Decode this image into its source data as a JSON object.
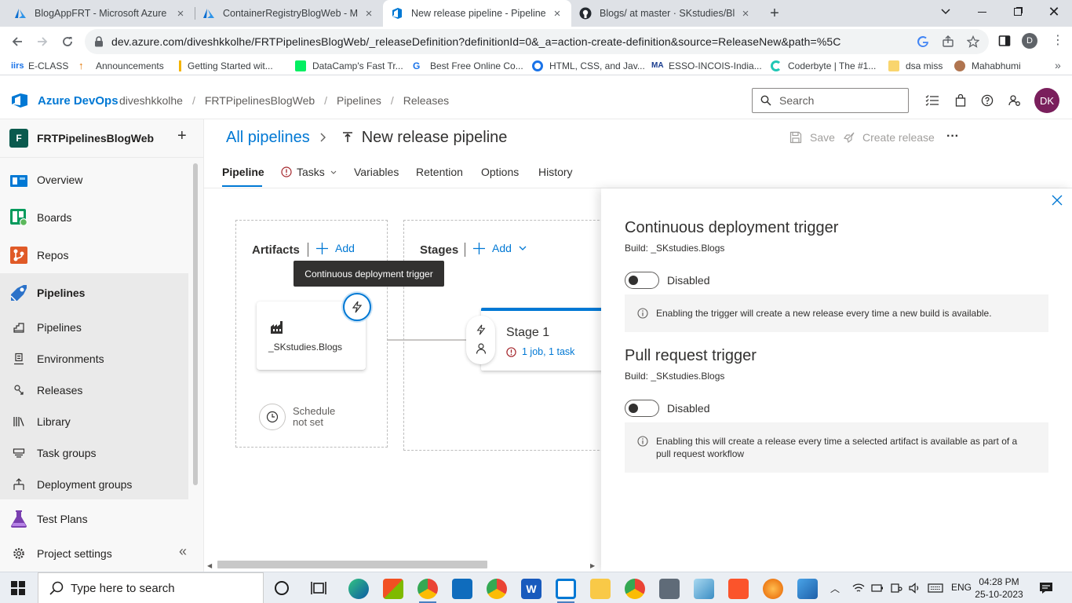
{
  "browser": {
    "tabs": [
      {
        "title": "BlogAppFRT - Microsoft Azure",
        "active": false
      },
      {
        "title": "ContainerRegistryBlogWeb - Mic",
        "active": false
      },
      {
        "title": "New release pipeline - Pipelines",
        "active": true
      },
      {
        "title": "Blogs/ at master · SKstudies/Blog",
        "active": false
      }
    ],
    "url": "dev.azure.com/diveshkkolhe/FRTPipelinesBlogWeb/_releaseDefinition?definitionId=0&_a=action-create-definition&source=ReleaseNew&path=%5C",
    "profile_initial": "D",
    "bookmarks": [
      "E-CLASS",
      "Announcements",
      "Getting Started wit...",
      "DataCamp's Fast Tr...",
      "Best Free Online Co...",
      "HTML, CSS, and Jav...",
      "ESSO-INCOIS-India...",
      "Coderbyte | The #1...",
      "dsa miss",
      "Mahabhumi"
    ]
  },
  "header": {
    "brand": "Azure DevOps",
    "breadcrumbs": [
      "diveshkkolhe",
      "FRTPipelinesBlogWeb",
      "Pipelines",
      "Releases"
    ],
    "search_placeholder": "Search",
    "avatar_initials": "DK"
  },
  "sidebar": {
    "project_initial": "F",
    "project_name": "FRTPipelinesBlogWeb",
    "add_label": "+",
    "items": [
      {
        "label": "Overview"
      },
      {
        "label": "Boards"
      },
      {
        "label": "Repos"
      },
      {
        "label": "Pipelines"
      }
    ],
    "subitems": [
      {
        "label": "Pipelines"
      },
      {
        "label": "Environments"
      },
      {
        "label": "Releases"
      },
      {
        "label": "Library"
      },
      {
        "label": "Task groups"
      },
      {
        "label": "Deployment groups"
      }
    ],
    "test_plans": "Test Plans",
    "project_settings": "Project settings",
    "collapse_glyph": "«"
  },
  "main": {
    "all_pipelines": "All pipelines",
    "title": "New release pipeline",
    "save": "Save",
    "create_release": "Create release",
    "more": "···",
    "tabs": [
      "Pipeline",
      "Tasks",
      "Variables",
      "Retention",
      "Options",
      "History"
    ],
    "artifacts_label": "Artifacts",
    "add_label": "Add",
    "stages_label": "Stages",
    "tooltip": "Continuous deployment trigger",
    "artifact_name": "_SKstudies.Blogs",
    "schedule_line1": "Schedule",
    "schedule_line2": "not set",
    "stage_name": "Stage 1",
    "stage_tasks": "1 job, 1 task"
  },
  "panel": {
    "cd_title": "Continuous deployment trigger",
    "cd_build": "Build: _SKstudies.Blogs",
    "cd_state": "Disabled",
    "cd_info": "Enabling the trigger will create a new release every time a new build is available.",
    "pr_title": "Pull request trigger",
    "pr_build": "Build: _SKstudies.Blogs",
    "pr_state": "Disabled",
    "pr_info": "Enabling this will create a release every time a selected artifact is available as part of a pull request workflow"
  },
  "taskbar": {
    "search_placeholder": "Type here to search",
    "lang": "ENG",
    "time": "04:28 PM",
    "date": "25-10-2023"
  },
  "colors": {
    "accent": "#0078d4",
    "error": "#a4262c",
    "avatar": "#7a1f5c"
  }
}
